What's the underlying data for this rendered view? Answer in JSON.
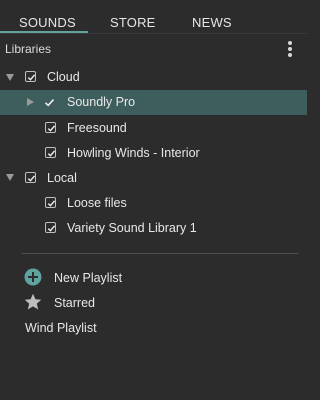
{
  "tabs": [
    {
      "label": "SOUNDS",
      "active": true
    },
    {
      "label": "STORE",
      "active": false
    },
    {
      "label": "NEWS",
      "active": false
    }
  ],
  "libraries": {
    "header": "Libraries",
    "menu_icon": "kebab-menu-icon",
    "groups": [
      {
        "label": "Cloud",
        "expanded": true,
        "checked": true,
        "items": [
          {
            "label": "Soundly Pro",
            "checked": true,
            "selected": true
          },
          {
            "label": "Freesound",
            "checked": true,
            "selected": false
          },
          {
            "label": "Howling Winds - Interior",
            "checked": true,
            "selected": false
          }
        ]
      },
      {
        "label": "Local",
        "expanded": true,
        "checked": true,
        "items": [
          {
            "label": "Loose files",
            "checked": true,
            "selected": false
          },
          {
            "label": "Variety Sound Library 1",
            "checked": true,
            "selected": false
          }
        ]
      }
    ]
  },
  "playlists": {
    "new_playlist": "New Playlist",
    "starred": "Starred",
    "items": [
      "Wind Playlist"
    ]
  },
  "colors": {
    "background": "#2c2c2c",
    "accent": "#5fa3a0",
    "selected_row": "#3d5e5d"
  }
}
